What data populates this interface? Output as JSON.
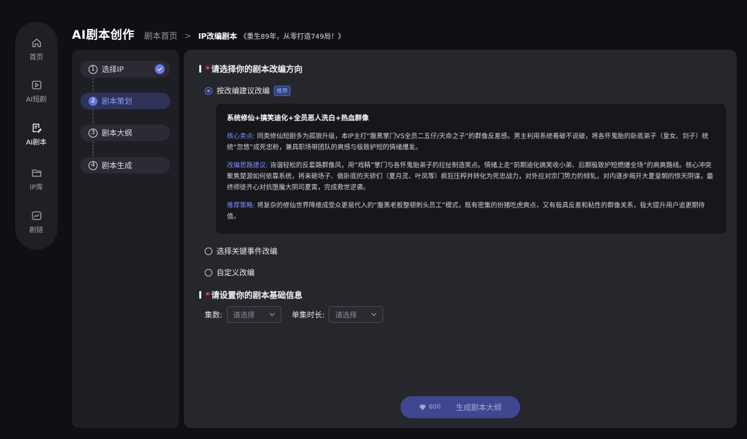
{
  "nav": {
    "items": [
      {
        "label": "首页",
        "icon": "home-icon"
      },
      {
        "label": "AI短剧",
        "icon": "video-icon"
      },
      {
        "label": "AI剧本",
        "icon": "script-icon"
      },
      {
        "label": "IP库",
        "icon": "folder-icon"
      },
      {
        "label": "剧链",
        "icon": "chart-icon"
      }
    ],
    "active_index": 2
  },
  "header": {
    "brand": "AI剧本创作",
    "breadcrumb_home": "剧本首页",
    "separator": ">",
    "current": "IP改编剧本",
    "current_sub": "《重生89年，从零打造749局！》"
  },
  "steps": [
    {
      "num": "1",
      "label": "选择IP",
      "done": true
    },
    {
      "num": "2",
      "label": "剧本策划",
      "active": true
    },
    {
      "num": "3",
      "label": "剧本大纲"
    },
    {
      "num": "4",
      "label": "剧本生成"
    }
  ],
  "direction": {
    "title": "请选择你的剧本改编方向",
    "required_mark": "*",
    "options": [
      {
        "label": "按改编建议改编",
        "badge": "推荐",
        "selected": true
      },
      {
        "label": "选择关键事件改编",
        "selected": false
      },
      {
        "label": "自定义改编",
        "selected": false
      }
    ],
    "suggestion": {
      "title": "系统修仙+搞笑迪化+全员恶人洗白+热血群像",
      "sections": [
        {
          "key": "核心卖点:",
          "text": "同类修仙短剧多为孤狼升级，本IP主打“腹黑掌门VS全员二五仔/天命之子”的群像反差感。男主利用系统看破不说破，将各怀鬼胎的卧底弟子（皇女、剑子）统统“忽悠”成死忠粉，兼具职场带团队的爽感与极致护短的情绪爆发。"
        },
        {
          "key": "改编思路建议:",
          "text": "诙谐轻松的反套路群像风，用“戏精”掌门与各怀鬼胎弟子的拉扯制造笑点。情绪上走“前期迪化搞笑收小弟、后期极致护短燃爆全场”的高爽路线。核心冲突聚焦楚源如何依靠系统，将来砸场子、做卧底的天骄们（夏月灵、叶凤等）疯狂压榨并转化为死忠战力，对外应对宗门势力的倾轧，对内逐步揭开大夏皇朝的惊天阴谋，最终师徒齐心对抗堕魔大阴司夏霄，完成救世逆袭。"
        },
        {
          "key": "推荐策略:",
          "text": "将复杂的修仙世界降维成受众更易代入的“腹黑老板整顿刺头员工”模式，既有密集的扮猪吃虎爽点，又有极具反差和粘性的群像关系，极大提升用户追更期待值。"
        }
      ]
    }
  },
  "basic_info": {
    "title": "请设置你的剧本基础信息",
    "required_mark": "*",
    "episodes_label": "集数:",
    "episodes_placeholder": "请选择",
    "duration_label": "单集时长:",
    "duration_placeholder": "请选择"
  },
  "generate": {
    "cost": "600",
    "label": "生成剧本大纲"
  },
  "colors": {
    "accent": "#6b78f0",
    "required": "#ff4d4f",
    "panel": "#26262d",
    "background": "#101014"
  }
}
